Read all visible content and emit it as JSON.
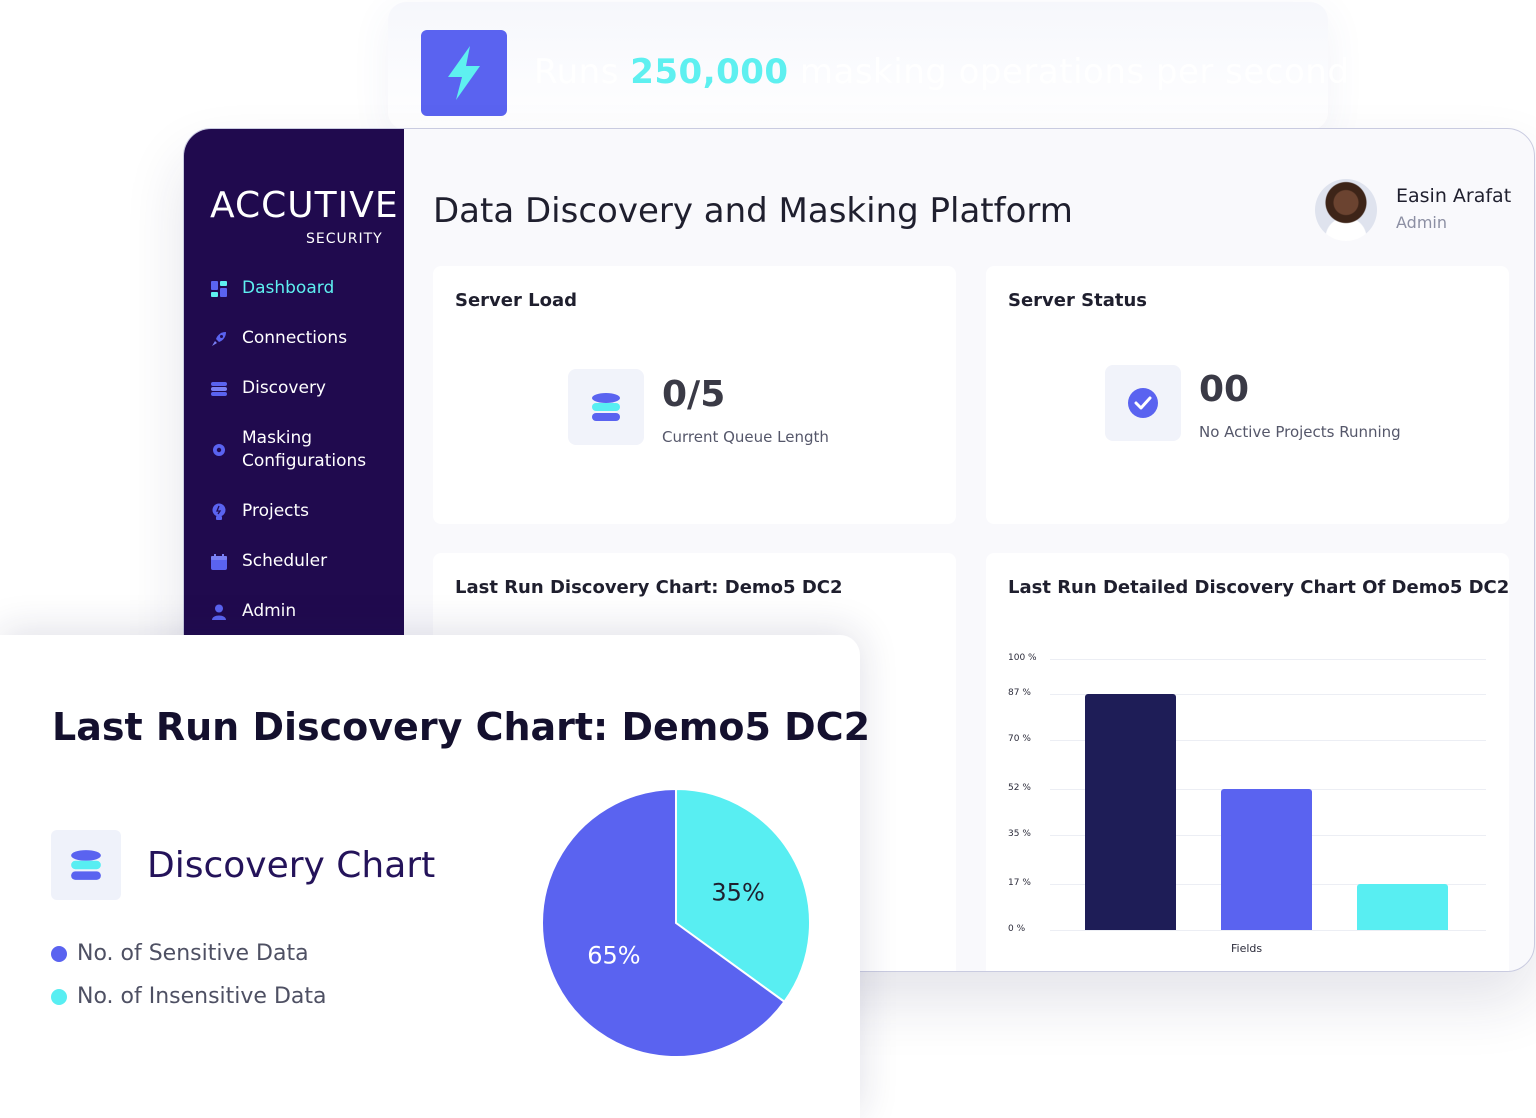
{
  "banner": {
    "prefix": "Runs ",
    "highlight": "250,000",
    "suffix": " masking operations per second"
  },
  "logo": {
    "main": "ACCUTIVE",
    "sub": "SECURITY"
  },
  "sidebar": {
    "items": [
      {
        "label": "Dashboard",
        "icon": "dashboard-icon",
        "active": true
      },
      {
        "label": "Connections",
        "icon": "rocket-icon"
      },
      {
        "label": "Discovery",
        "icon": "database-icon"
      },
      {
        "label": "Masking Configurations",
        "icon": "gear-icon"
      },
      {
        "label": "Projects",
        "icon": "bulb-icon"
      },
      {
        "label": "Scheduler",
        "icon": "calendar-icon"
      },
      {
        "label": "Admin",
        "icon": "user-icon"
      }
    ]
  },
  "header": {
    "title": "Data Discovery and Masking Platform"
  },
  "user": {
    "name": "Easin Arafat",
    "role": "Admin"
  },
  "server_load": {
    "title": "Server Load",
    "value": "0/5",
    "label": "Current Queue Length"
  },
  "server_status": {
    "title": "Server Status",
    "value": "00",
    "label": "No Active Projects Running"
  },
  "discovery_card": {
    "title": "Last Run Discovery Chart: Demo5 DC2"
  },
  "detailed_card": {
    "title": "Last Run Detailed Discovery Chart Of Demo5 DC2"
  },
  "float_card": {
    "title": "Last Run Discovery Chart: Demo5 DC2",
    "subtitle": "Discovery Chart",
    "legend": [
      {
        "label": "No. of Sensitive Data",
        "color": "#5a63f0"
      },
      {
        "label": "No. of Insensitive Data",
        "color": "#58eef2"
      }
    ]
  },
  "colors": {
    "sidebar": "#200a4e",
    "accent": "#5a63f0",
    "cyan": "#58eef2",
    "navy": "#1e1d57"
  },
  "chart_data": [
    {
      "type": "bar",
      "categories": [
        "",
        "",
        ""
      ],
      "values": [
        87,
        52,
        17
      ],
      "colors": [
        "#1e1d57",
        "#5a63f0",
        "#58eef2"
      ],
      "xlabel": "Fields",
      "ylim": [
        0,
        100
      ],
      "yticks": [
        "100 %",
        "87 %",
        "70 %",
        "52 %",
        "35 %",
        "17 %",
        "0 %"
      ],
      "ytick_values": [
        100,
        87,
        70,
        52,
        35,
        17,
        0
      ],
      "grid": true
    },
    {
      "type": "pie",
      "values": [
        35,
        65
      ],
      "labels": [
        "35%",
        "65%"
      ],
      "colors": [
        "#58eef2",
        "#5a63f0"
      ],
      "series_names": [
        "No. of Insensitive Data",
        "No. of Sensitive Data"
      ]
    }
  ]
}
